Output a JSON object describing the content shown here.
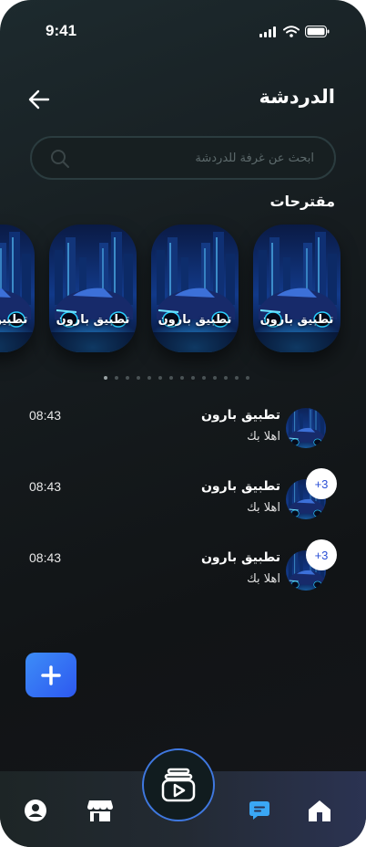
{
  "status_bar": {
    "time": "9:41"
  },
  "header": {
    "title": "الدردشة"
  },
  "search": {
    "placeholder": "ابحث عن غرفة للدردشة"
  },
  "suggestions": {
    "label": "مقترحات",
    "cards": [
      {
        "label": "تطبيق بارون"
      },
      {
        "label": "تطبيق بارون"
      },
      {
        "label": "تطبيق بارون"
      },
      {
        "label": "تطبيق بارون"
      }
    ],
    "dot_count": 14,
    "active_dot": 0
  },
  "chats": [
    {
      "name": "تطبيق بارون",
      "message": "اهلا بك",
      "time": "08:43",
      "badge": ""
    },
    {
      "name": "تطبيق بارون",
      "message": "اهلا بك",
      "time": "08:43",
      "badge": "+3"
    },
    {
      "name": "تطبيق بارون",
      "message": "اهلا بك",
      "time": "08:43",
      "badge": "+3"
    }
  ],
  "fab": {
    "icon": "plus-icon"
  },
  "bottom_nav": {
    "items": [
      "profile-icon",
      "store-icon",
      "play-stack-icon",
      "chat-icon",
      "home-icon"
    ],
    "active": "chat-icon"
  },
  "colors": {
    "accent": "#2d6bf0",
    "chat_active": "#3aa7f5",
    "background": "#161c1f"
  }
}
